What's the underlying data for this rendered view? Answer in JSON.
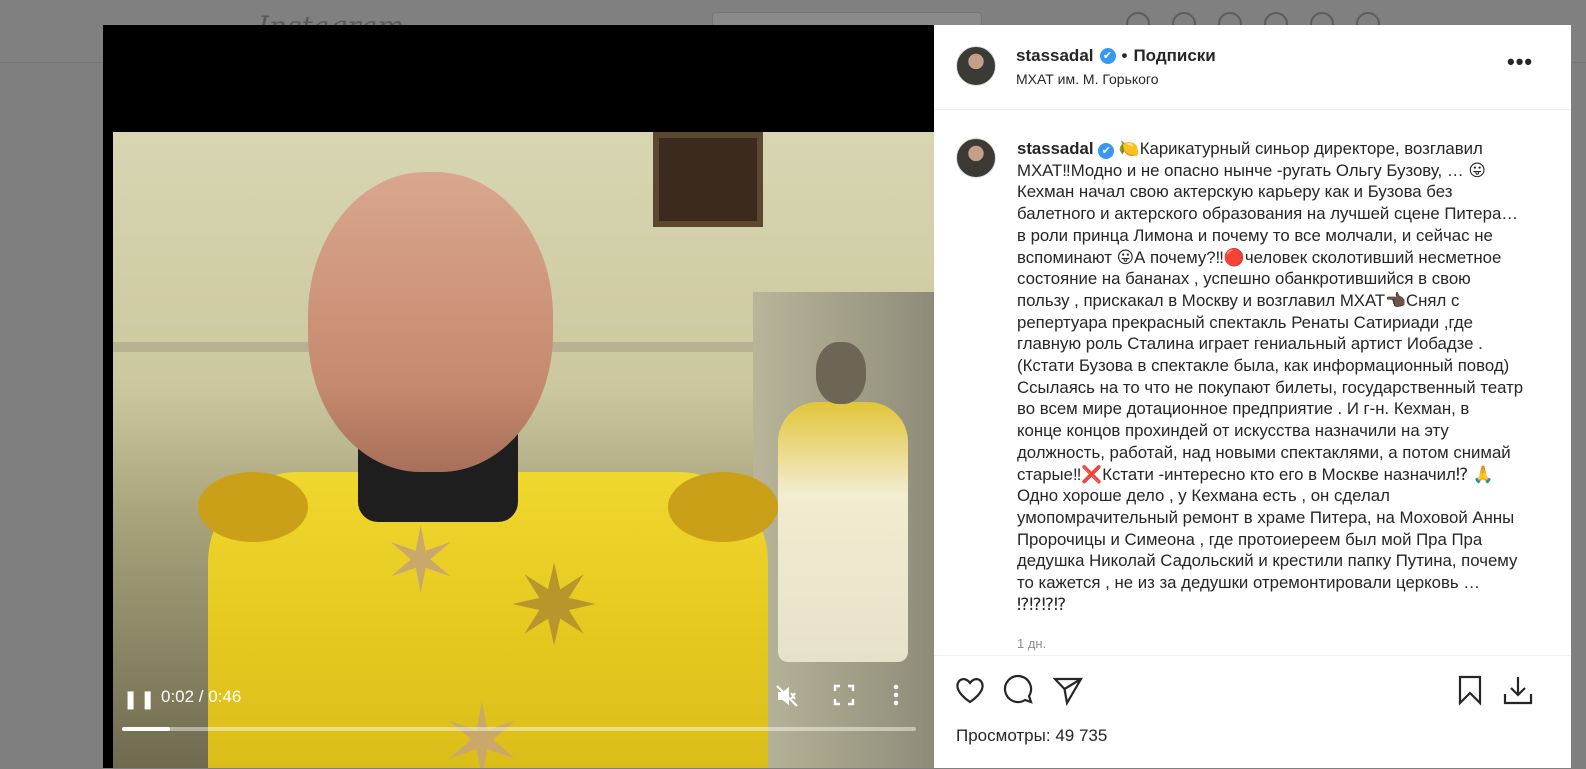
{
  "video": {
    "time": "0:02 / 0:46",
    "progress": 0.06
  },
  "post": {
    "username": "stassadal",
    "verified_mark": "✔",
    "separator": "•",
    "follow_label": "Подписки",
    "location": "МХАТ им. М. Горького",
    "more": "•••",
    "caption_lines": [
      "🍋Карикатурный синьор директоре, возглавил",
      "МХАТ‼Модно и не опасно нынче -ругать Ольгу Бузову, … 😛",
      "Кехман начал свою актерскую карьеру как и Бузова без",
      "балетного и актерского образования на лучшей сцене Питера…",
      "в роли принца Лимона и почему то все молчали, и сейчас не",
      "вспоминают 😛А почему?‼🔴человек сколотивший несметное",
      "состояние на бананах , успешно обанкротившийся в свою",
      "пользу , прискакал в Москву и возглавил МХАТ👈🏿Снял с",
      "репертуара прекрасный спектакль Ренаты Сатириади ,где",
      "главную роль Сталина играет гениальный артист Иобадзе .",
      "(Кстати Бузова в спектакле была, как информационный повод)",
      "Ссылаясь на то что не покупают билеты, государственный театр",
      "во всем мире дотационное предприятие . И г-н. Кехман, в",
      "конце концов прохиндей от искусства назначили на эту",
      "должность, работай, над новыми спектаклями, а потом снимай",
      "старые‼❌Кстати -интересно кто его в Москве назначил⁉ 🙏",
      "Одно хороше дело , у Кехмана есть , он сделал",
      "умопомрачительный ремонт в храме Питера, на Моховой Анны",
      "Пророчицы и Симеона , где протоиереем был мой Пра Пра",
      "дедушка Николай Садольский и крестили папку Путина, почему",
      "то кажется , не из за дедушки отремонтировали церковь …",
      "⁉⁉⁉⁉"
    ],
    "time_ago": "1 дн.",
    "views_label": "Просмотры:",
    "views_count": "49 735"
  },
  "icons": {
    "like": "heart-icon",
    "comment": "comment-icon",
    "share": "paper-plane-icon",
    "save": "bookmark-icon",
    "download": "download-icon"
  },
  "colors": {
    "verified": "#3897f0",
    "text": "#262626",
    "muted": "#8e8e8e"
  }
}
